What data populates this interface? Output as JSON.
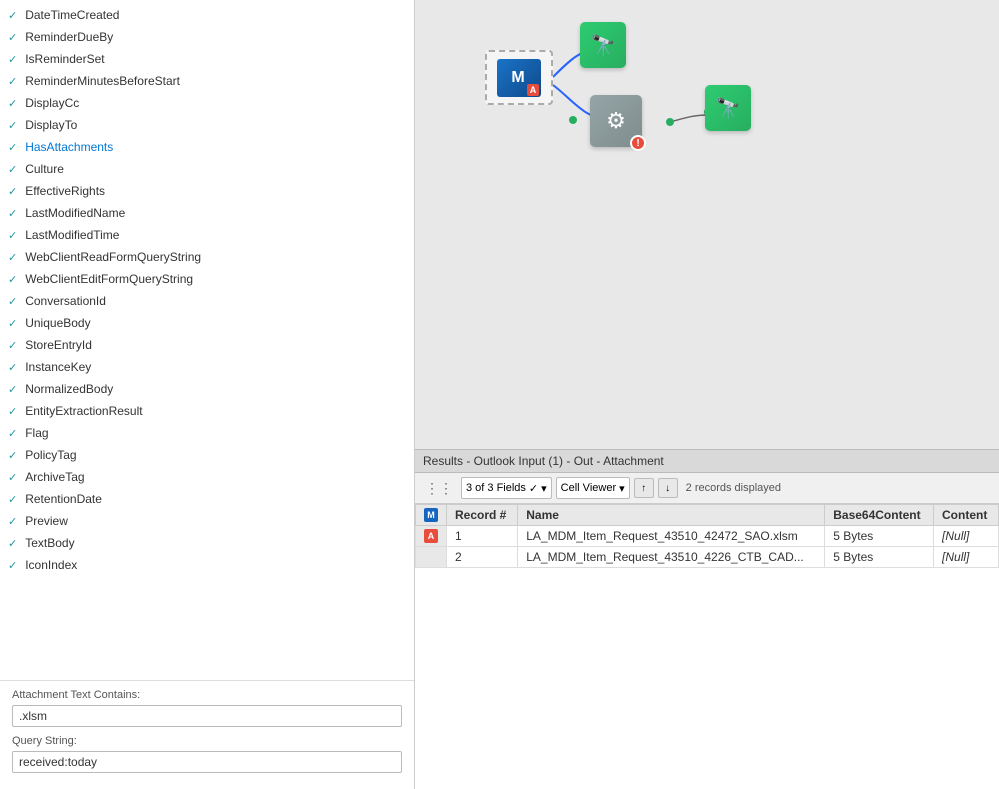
{
  "leftPanel": {
    "fields": [
      {
        "id": "DateTimeCreated",
        "label": "DateTimeCreated",
        "checked": true,
        "highlighted": false
      },
      {
        "id": "ReminderDueBy",
        "label": "ReminderDueBy",
        "checked": true,
        "highlighted": false
      },
      {
        "id": "IsReminderSet",
        "label": "IsReminderSet",
        "checked": true,
        "highlighted": false
      },
      {
        "id": "ReminderMinutesBeforeStart",
        "label": "ReminderMinutesBeforeStart",
        "checked": true,
        "highlighted": false
      },
      {
        "id": "DisplayCc",
        "label": "DisplayCc",
        "checked": true,
        "highlighted": false
      },
      {
        "id": "DisplayTo",
        "label": "DisplayTo",
        "checked": true,
        "highlighted": false
      },
      {
        "id": "HasAttachments",
        "label": "HasAttachments",
        "checked": true,
        "highlighted": true
      },
      {
        "id": "Culture",
        "label": "Culture",
        "checked": true,
        "highlighted": false
      },
      {
        "id": "EffectiveRights",
        "label": "EffectiveRights",
        "checked": true,
        "highlighted": false
      },
      {
        "id": "LastModifiedName",
        "label": "LastModifiedName",
        "checked": true,
        "highlighted": false
      },
      {
        "id": "LastModifiedTime",
        "label": "LastModifiedTime",
        "checked": true,
        "highlighted": false
      },
      {
        "id": "WebClientReadFormQueryString",
        "label": "WebClientReadFormQueryString",
        "checked": true,
        "highlighted": false
      },
      {
        "id": "WebClientEditFormQueryString",
        "label": "WebClientEditFormQueryString",
        "checked": true,
        "highlighted": false
      },
      {
        "id": "ConversationId",
        "label": "ConversationId",
        "checked": true,
        "highlighted": false
      },
      {
        "id": "UniqueBody",
        "label": "UniqueBody",
        "checked": true,
        "highlighted": false
      },
      {
        "id": "StoreEntryId",
        "label": "StoreEntryId",
        "checked": true,
        "highlighted": false
      },
      {
        "id": "InstanceKey",
        "label": "InstanceKey",
        "checked": true,
        "highlighted": false
      },
      {
        "id": "NormalizedBody",
        "label": "NormalizedBody",
        "checked": true,
        "highlighted": false
      },
      {
        "id": "EntityExtractionResult",
        "label": "EntityExtractionResult",
        "checked": true,
        "highlighted": false
      },
      {
        "id": "Flag",
        "label": "Flag",
        "checked": true,
        "highlighted": false
      },
      {
        "id": "PolicyTag",
        "label": "PolicyTag",
        "checked": true,
        "highlighted": false
      },
      {
        "id": "ArchiveTag",
        "label": "ArchiveTag",
        "checked": true,
        "highlighted": false
      },
      {
        "id": "RetentionDate",
        "label": "RetentionDate",
        "checked": true,
        "highlighted": false
      },
      {
        "id": "Preview",
        "label": "Preview",
        "checked": true,
        "highlighted": false
      },
      {
        "id": "TextBody",
        "label": "TextBody",
        "checked": true,
        "highlighted": false
      },
      {
        "id": "IconIndex",
        "label": "IconIndex",
        "checked": true,
        "highlighted": false
      }
    ],
    "attachmentTextContains": {
      "label": "Attachment Text Contains:",
      "value": ".xlsm"
    },
    "queryString": {
      "label": "Query String:",
      "value": "received:today"
    }
  },
  "canvas": {
    "nodes": [
      {
        "id": "outlook-input",
        "label": "Outlook Input"
      },
      {
        "id": "browse1",
        "label": "Browse Tool 1"
      },
      {
        "id": "transform",
        "label": "Transform Tool"
      },
      {
        "id": "browse2",
        "label": "Browse Tool 2"
      }
    ]
  },
  "results": {
    "headerText": "Results - Outlook Input (1) - Out - Attachment",
    "fieldsCount": "3 of 3 Fields",
    "cellViewer": "Cell Viewer",
    "recordsDisplayed": "2 records displayed",
    "columns": [
      {
        "id": "record_num",
        "label": "Record #"
      },
      {
        "id": "name",
        "label": "Name"
      },
      {
        "id": "base64content",
        "label": "Base64Content"
      },
      {
        "id": "content",
        "label": "Content"
      }
    ],
    "rows": [
      {
        "record": "1",
        "name": "LA_MDM_Item_Request_43510_42472_SAO.xlsm",
        "base64content": "5 Bytes",
        "content": "[Null]"
      },
      {
        "record": "2",
        "name": "LA_MDM_Item_Request_43510_4226_CTB_CAD...",
        "base64content": "5 Bytes",
        "content": "[Null]"
      }
    ],
    "mBadgeLabel": "M",
    "aBadgeLabel": "A"
  }
}
